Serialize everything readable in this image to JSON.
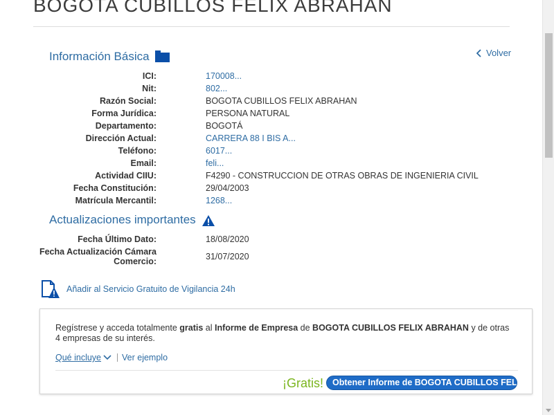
{
  "header": {
    "company_name": "BOGOTA CUBILLOS FELIX ABRAHAN"
  },
  "basic_info": {
    "title": "Información Básica",
    "back_label": "Volver",
    "rows": [
      {
        "label": "ICI:",
        "value": "170008...",
        "link": true
      },
      {
        "label": "Nit:",
        "value": "802...",
        "link": true
      },
      {
        "label": "Razón Social:",
        "value": "BOGOTA CUBILLOS FELIX ABRAHAN",
        "link": false
      },
      {
        "label": "Forma Jurídica:",
        "value": "PERSONA NATURAL",
        "link": false
      },
      {
        "label": "Departamento:",
        "value": "BOGOTÁ",
        "link": false
      },
      {
        "label": "Dirección Actual:",
        "value": "CARRERA 88 I BIS A...",
        "link": true
      },
      {
        "label": "Teléfono:",
        "value": "6017...",
        "link": true
      },
      {
        "label": "Email:",
        "value": "feli...",
        "link": true
      },
      {
        "label": "Actividad CIIU:",
        "value": "F4290 - CONSTRUCCION DE OTRAS OBRAS DE INGENIERIA CIVIL",
        "link": false
      },
      {
        "label": "Fecha Constitución:",
        "value": "29/04/2003",
        "link": false
      },
      {
        "label": "Matrícula Mercantil:",
        "value": "1268...",
        "link": true
      }
    ]
  },
  "updates": {
    "title": "Actualizaciones importantes",
    "rows": [
      {
        "label": "Fecha Último Dato:",
        "value": "18/08/2020"
      },
      {
        "label": "Fecha Actualización Cámara Comercio:",
        "value": "31/07/2020"
      }
    ]
  },
  "watch": {
    "label": "Añadir al Servicio Gratuito de Vigilancia 24h"
  },
  "promo": {
    "text_1": "Regístrese y acceda totalmente ",
    "text_bold_1": "gratis",
    "text_2": " al ",
    "text_bold_2": "Informe de Empresa",
    "text_3": " de ",
    "text_bold_3": "BOGOTA CUBILLOS FELIX ABRAHAN",
    "text_4": " y de otras 4 empresas de su interés.",
    "que_incluye": "Qué incluye",
    "ver_ejemplo": "Ver ejemplo",
    "gratis_label": "¡Gratis!",
    "button_label": "Obtener Informe de BOGOTA CUBILLOS FELI..."
  },
  "colors": {
    "link": "#2e6ca3",
    "folder_icon": "#0b4fa8",
    "gratis": "#7ab51d",
    "button": "#1f6cc7"
  }
}
